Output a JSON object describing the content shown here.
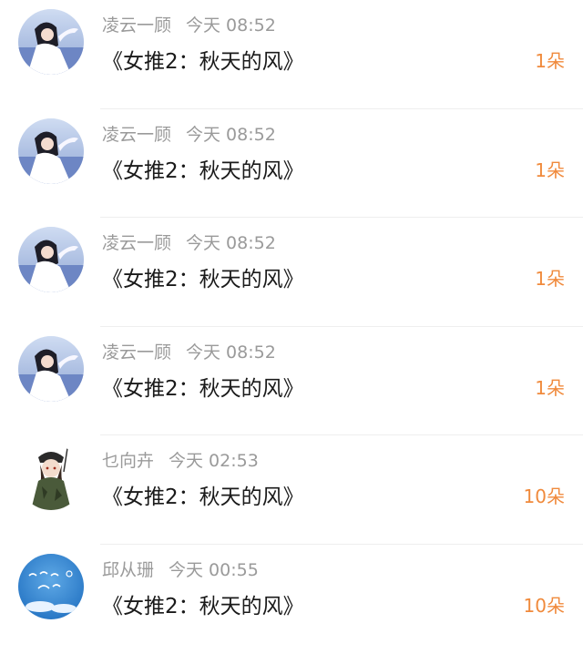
{
  "messages": [
    {
      "user": "凌云一顾",
      "time": "今天 08:52",
      "title": "《女推2：秋天的风》",
      "count": "1朵",
      "avatar": "avatar-girl-sky"
    },
    {
      "user": "凌云一顾",
      "time": "今天 08:52",
      "title": "《女推2：秋天的风》",
      "count": "1朵",
      "avatar": "avatar-girl-sky"
    },
    {
      "user": "凌云一顾",
      "time": "今天 08:52",
      "title": "《女推2：秋天的风》",
      "count": "1朵",
      "avatar": "avatar-girl-sky"
    },
    {
      "user": "凌云一顾",
      "time": "今天 08:52",
      "title": "《女推2：秋天的风》",
      "count": "1朵",
      "avatar": "avatar-girl-sky"
    },
    {
      "user": "乜向卉",
      "time": "今天 02:53",
      "title": "《女推2：秋天的风》",
      "count": "10朵",
      "avatar": "avatar-anime-soldier"
    },
    {
      "user": "邱从珊",
      "time": "今天 00:55",
      "title": "《女推2：秋天的风》",
      "count": "10朵",
      "avatar": "avatar-blue-sky-text"
    }
  ],
  "colors": {
    "count": "#f08a3c",
    "meta": "#9a9a9a",
    "title": "#1a1a1a"
  }
}
